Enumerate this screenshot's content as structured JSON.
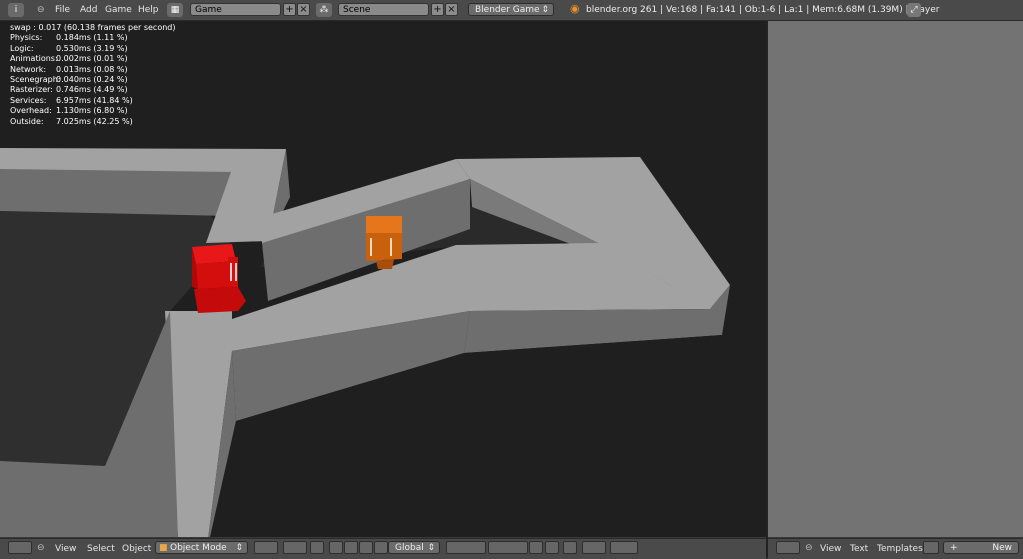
{
  "topbar": {
    "menus": [
      "File",
      "Add",
      "Game",
      "Help"
    ],
    "screen_layout": "Game",
    "scene": "Scene",
    "render_engine": "Blender Game",
    "info": "blender.org 261 | Ve:168 | Fa:141 | Ob:1-6 | La:1 | Mem:6.68M (1.39M) | Player"
  },
  "stats": {
    "header": "swap : 0.017 (60.138 frames per second)",
    "rows": [
      {
        "label": "Physics:",
        "value": "0.184ms (1.11 %)"
      },
      {
        "label": "Logic:",
        "value": "0.530ms (3.19 %)"
      },
      {
        "label": "Animations:",
        "value": "0.002ms (0.01 %)"
      },
      {
        "label": "Network:",
        "value": "0.013ms (0.08 %)"
      },
      {
        "label": "Scenegraph:",
        "value": "0.040ms (0.24 %)"
      },
      {
        "label": "Rasterizer:",
        "value": "0.746ms (4.49 %)"
      },
      {
        "label": "Services:",
        "value": "6.957ms (41.84 %)"
      },
      {
        "label": "Overhead:",
        "value": "1.130ms (6.80 %)"
      },
      {
        "label": "Outside:",
        "value": "7.025ms (42.25 %)"
      }
    ]
  },
  "viewport_header": {
    "menus": [
      "View",
      "Select",
      "Object"
    ],
    "mode": "Object Mode",
    "orientation": "Global"
  },
  "text_editor_header": {
    "menus": [
      "View",
      "Text",
      "Templates"
    ],
    "new_label": "New"
  },
  "colors": {
    "wall_top": "#a2a2a2",
    "wall_side": "#6e6e6e",
    "floor": "#2f2f2f",
    "background": "#1f1f1f",
    "red_cube": "#cc0a0a",
    "orange_cube": "#d2640f"
  }
}
